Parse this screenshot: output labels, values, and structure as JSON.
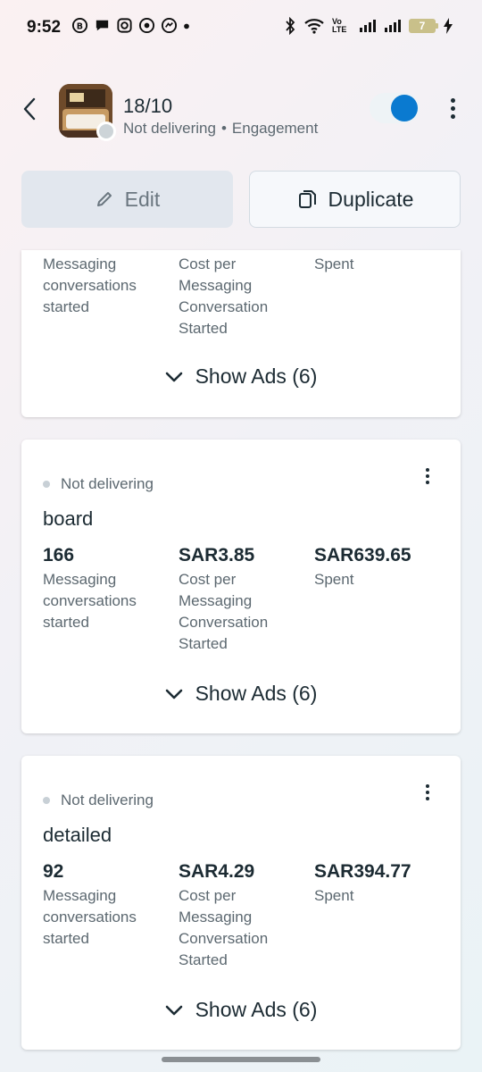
{
  "status_bar": {
    "time": "9:52",
    "battery": "7",
    "network_label": "Vo LTE"
  },
  "header": {
    "title": "18/10",
    "status": "Not delivering",
    "separator": "•",
    "objective": "Engagement"
  },
  "actions": {
    "edit_label": "Edit",
    "duplicate_label": "Duplicate"
  },
  "partial_card": {
    "metric1_label": "Messaging conversations started",
    "metric2_label": "Cost per Messaging Conversation Started",
    "metric3_label": "Spent",
    "show_ads": "Show Ads (6)"
  },
  "ad_sets": [
    {
      "status": "Not delivering",
      "name": "board",
      "conversations": "166",
      "conversations_label": "Messaging conversations started",
      "cost": "SAR3.85",
      "cost_label": "Cost per Messaging Conversation Started",
      "spent": "SAR639.65",
      "spent_label": "Spent",
      "show_ads": "Show Ads (6)"
    },
    {
      "status": "Not delivering",
      "name": "detailed",
      "conversations": "92",
      "conversations_label": "Messaging conversations started",
      "cost": "SAR4.29",
      "cost_label": "Cost per Messaging Conversation Started",
      "spent": "SAR394.77",
      "spent_label": "Spent",
      "show_ads": "Show Ads (6)"
    }
  ],
  "colors": {
    "accent": "#0a7ad0",
    "text": "#1c2b33",
    "muted": "#5c6870"
  }
}
